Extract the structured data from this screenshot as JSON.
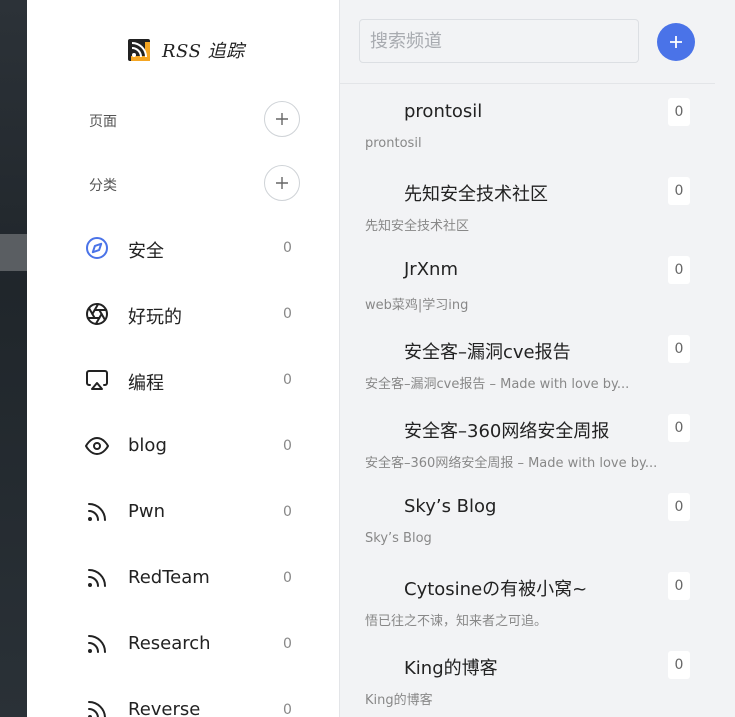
{
  "app": {
    "title": "RSS 追踪"
  },
  "sidebar": {
    "pages_label": "页面",
    "categories_label": "分类",
    "categories": [
      {
        "label": "安全",
        "count": "0",
        "icon": "compass-icon",
        "color": "#4a73e8"
      },
      {
        "label": "好玩的",
        "count": "0",
        "icon": "aperture-icon"
      },
      {
        "label": "编程",
        "count": "0",
        "icon": "airplay-icon"
      },
      {
        "label": "blog",
        "count": "0",
        "icon": "eye-icon"
      },
      {
        "label": "Pwn",
        "count": "0",
        "icon": "rss-icon"
      },
      {
        "label": "RedTeam",
        "count": "0",
        "icon": "rss-icon"
      },
      {
        "label": "Research",
        "count": "0",
        "icon": "rss-icon"
      },
      {
        "label": "Reverse",
        "count": "0",
        "icon": "rss-icon"
      }
    ]
  },
  "search": {
    "placeholder": "搜索频道"
  },
  "channels": [
    {
      "title": "prontosil",
      "subtitle": "prontosil",
      "count": "0"
    },
    {
      "title": "先知安全技术社区",
      "subtitle": "先知安全技术社区",
      "count": "0"
    },
    {
      "title": "JrXnm",
      "subtitle": "web菜鸡|学习ing",
      "count": "0"
    },
    {
      "title": "安全客–漏洞cve报告",
      "subtitle": "安全客–漏洞cve报告 – Made with love by...",
      "count": "0"
    },
    {
      "title": "安全客–360网络安全周报",
      "subtitle": "安全客–360网络安全周报 – Made with love by...",
      "count": "0"
    },
    {
      "title": "Sky’s Blog",
      "subtitle": "Sky’s Blog",
      "count": "0"
    },
    {
      "title": "Cytosineの有被小窝~",
      "subtitle": "悟已往之不谏，知来者之可追。",
      "count": "0"
    },
    {
      "title": "King的博客",
      "subtitle": "King的博客",
      "count": "0"
    }
  ],
  "colors": {
    "accent": "#4a73e8",
    "panel_bg": "#f2f3f5"
  }
}
